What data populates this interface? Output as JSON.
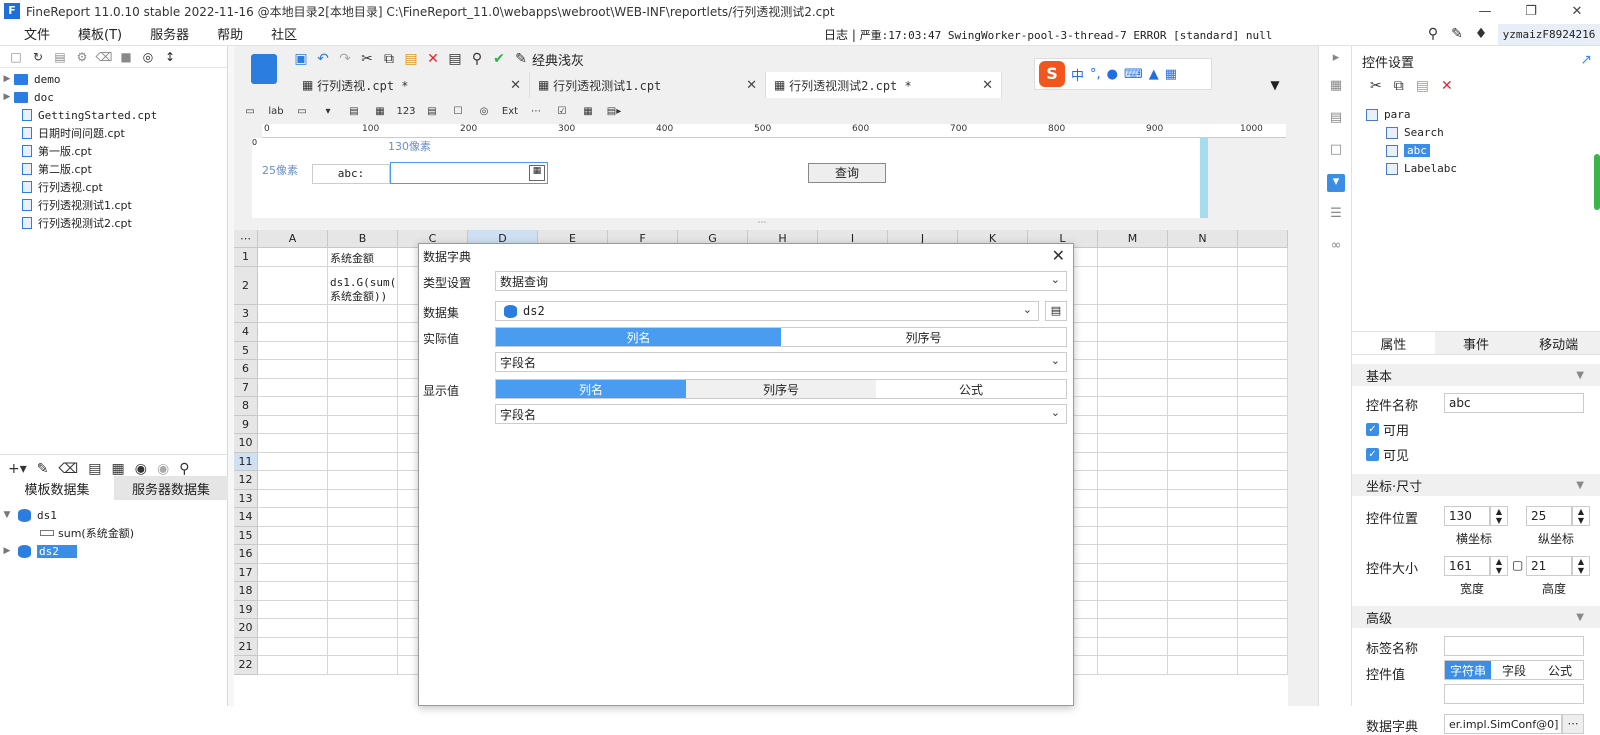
{
  "window": {
    "app_name": "FineReport",
    "title": "FineReport 11.0.10 stable 2022-11-16 @本地目录2[本地目录]    C:\\FineReport_11.0\\webapps\\webroot\\WEB-INF\\reportlets/行列透视测试2.cpt",
    "logo_letter": "F"
  },
  "menu": [
    "文件",
    "模板(T)",
    "服务器",
    "帮助",
    "社区"
  ],
  "log": {
    "label": "日志",
    "message": "严重:17:03:47 SwingWorker-pool-3-thread-7 ERROR [standard] null"
  },
  "user": "yzmaizF8924216",
  "file_tree": {
    "folders": [
      "demo",
      "doc"
    ],
    "files": [
      "GettingStarted.cpt",
      "日期时间问题.cpt",
      "第一版.cpt",
      "第二版.cpt",
      "行列透视.cpt",
      "行列透视测试1.cpt",
      "行列透视测试2.cpt"
    ]
  },
  "dataset_tabs": {
    "template": "模板数据集",
    "server": "服务器数据集"
  },
  "datasets": {
    "ds1": "ds1",
    "ds1_field": "sum(系统金额)",
    "ds2": "ds2"
  },
  "toolbar": {
    "style_label": "经典浅灰"
  },
  "editor_tabs": [
    {
      "label": "行列透视.cpt *"
    },
    {
      "label": "行列透视测试1.cpt"
    },
    {
      "label": "行列透视测试2.cpt *"
    }
  ],
  "ime": {
    "logo": "S",
    "mode": "中",
    "punct": "°,"
  },
  "ruler": [
    "0",
    "100",
    "200",
    "300",
    "400",
    "500",
    "600",
    "700",
    "800",
    "900",
    "1000"
  ],
  "param": {
    "top_hint": "130像素",
    "left_hint": "25像素",
    "label": "abc:",
    "query_button": "查询",
    "vruler_zero": "0"
  },
  "grid": {
    "columns": [
      "A",
      "B",
      "C",
      "D",
      "E",
      "F",
      "G",
      "H",
      "I",
      "J",
      "K",
      "L",
      "M",
      "N"
    ],
    "rows": [
      "1",
      "2",
      "3",
      "4",
      "5",
      "6",
      "7",
      "8",
      "9",
      "10",
      "11",
      "12",
      "13",
      "14",
      "15",
      "16",
      "17",
      "18",
      "19",
      "20",
      "21",
      "22"
    ],
    "b1": "系统金额",
    "b2_line1": "ds1.G(sum(",
    "b2_line2": "系统金额))"
  },
  "dialog": {
    "title": "数据字典",
    "type_label": "类型设置",
    "type_value": "数据查询",
    "dataset_label": "数据集",
    "dataset_value": "ds2",
    "actual_label": "实际值",
    "actual_options": [
      "列名",
      "列序号"
    ],
    "actual_field": "字段名",
    "display_label": "显示值",
    "display_options": [
      "列名",
      "列序号",
      "公式"
    ],
    "display_field": "字段名"
  },
  "right_panel": {
    "title": "控件设置",
    "tree": {
      "root": "para",
      "children": [
        "Search",
        "abc",
        "Labelabc"
      ]
    },
    "tabs": [
      "属性",
      "事件",
      "移动端"
    ],
    "basic": "基本",
    "name_label": "控件名称",
    "name_value": "abc",
    "enabled": "可用",
    "visible": "可见",
    "geo_section": "坐标·尺寸",
    "pos_label": "控件位置",
    "pos_x": "130",
    "pos_y": "25",
    "x_caption": "横坐标",
    "y_caption": "纵坐标",
    "size_label": "控件大小",
    "width": "161",
    "height": "21",
    "w_caption": "宽度",
    "h_caption": "高度",
    "advanced": "高级",
    "tag_label": "标签名称",
    "value_label": "控件值",
    "value_options": [
      "字符串",
      "字段",
      "公式"
    ],
    "dict_label": "数据字典",
    "dict_value": "er.impl.SimConf@0]"
  }
}
